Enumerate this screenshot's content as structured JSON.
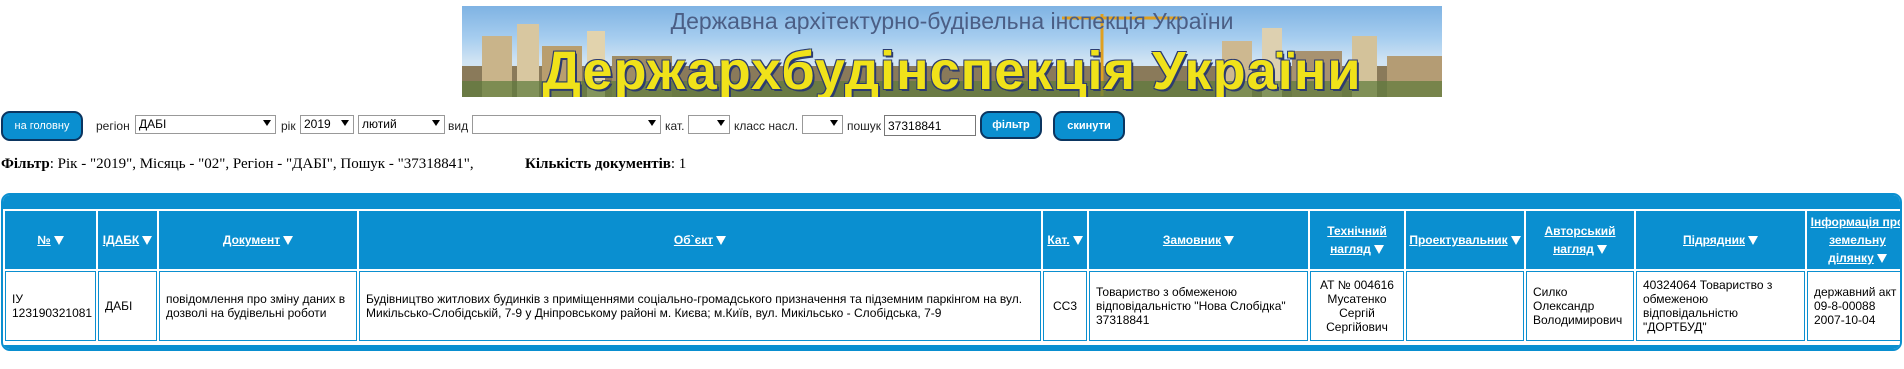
{
  "banner": {
    "subtitle": "Державна архітектурно-будівельна інспекція України",
    "title": "Держархбудінспекція України"
  },
  "toolbar": {
    "home_label": "на головну",
    "region_label": "регіон",
    "region_value": "ДАБІ",
    "year_label": "рік",
    "year_value": "2019",
    "month_value": "лютий",
    "type_label": "вид",
    "type_value": "",
    "cat_label": "кат.",
    "cat_value": "",
    "class_label": "класс насл.",
    "class_value": "",
    "search_label": "пошук",
    "search_value": "37318841",
    "filter_label": "фільтр",
    "reset_label": "скинути"
  },
  "filter_summary": {
    "filter_label": "Фільтр",
    "filter_text": ": Рік - \"2019\", Місяць - \"02\", Регіон - \"ДАБІ\", Пошук - \"37318841\",",
    "count_label": "Кількість документів",
    "count_value": ": 1"
  },
  "table": {
    "headers": {
      "num": "№",
      "idabk": "ІДАБК",
      "document": "Документ",
      "object": "Об`єкт",
      "cat": "Кат.",
      "customer": "Замовник",
      "tech_supervision": "Технічний нагляд",
      "designer": "Проектувальник",
      "author_supervision": "Авторський нагляд",
      "contractor": "Підрядник",
      "land_info": "Інформація про земельну ділянку"
    },
    "rows": [
      {
        "num": "ІУ 123190321081",
        "idabk": "ДАБІ",
        "document": "повідомлення про зміну даних в дозволі на будівельні роботи",
        "object": "Будівництво житлових будинків з приміщеннями соціально-громадського призначення та підземним паркінгом на вул. Микільсько-Слобідській, 7-9 у Дніпровському районі м. Києва; м.Київ, вул. Микільсько - Слобідська, 7-9",
        "cat": "СС3",
        "customer": "Товариство з обмеженою відповідальністю \"Нова Слобідка\" 37318841",
        "tech_supervision": "АТ № 004616 Мусатенко Сергій Сергійович",
        "designer": "",
        "author_supervision": "Силко Олександр Володимирович",
        "contractor": "40324064 Товариство з обмеженою відповідальністю \"ДОРТБУД\"",
        "land_info": "державний акт 09-8-00088 2007-10-04"
      }
    ]
  },
  "colors": {
    "accent": "#0a8fd0",
    "button_border": "#0b3560",
    "banner_title": "#f0e21a"
  }
}
